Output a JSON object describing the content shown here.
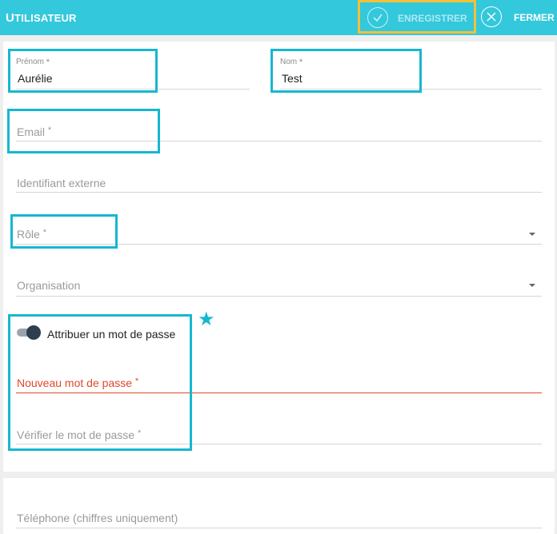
{
  "header": {
    "title_cap": "U",
    "title_rest": "TILISATEUR",
    "save_label": "ENREGISTRER",
    "close_label": "FERMER"
  },
  "form": {
    "prenom": {
      "label": "Prénom",
      "value": "Aurélie"
    },
    "nom": {
      "label": "Nom",
      "value": "Test"
    },
    "email": {
      "label": "Email"
    },
    "external_id": {
      "label": "Identifiant externe"
    },
    "role": {
      "label": "Rôle"
    },
    "organisation": {
      "label": "Organisation"
    },
    "password_toggle": {
      "label": "Attribuer un mot de passe",
      "on": true
    },
    "new_password": {
      "label": "Nouveau mot de passe"
    },
    "verify_password": {
      "label": "Vérifier le mot de passe"
    },
    "phone": {
      "label": "Téléphone (chiffres uniquement)"
    },
    "required_mark": "*"
  },
  "colors": {
    "header": "#33c8dc",
    "highlight": "#17b7d0",
    "save_highlight": "#f3c03a",
    "error": "#e0482a",
    "toggle_knob": "#2d3e4f"
  },
  "icons": {
    "save": "check-circle-icon",
    "close": "close-circle-icon",
    "dropdown": "caret-down-icon",
    "marker": "star-icon"
  }
}
